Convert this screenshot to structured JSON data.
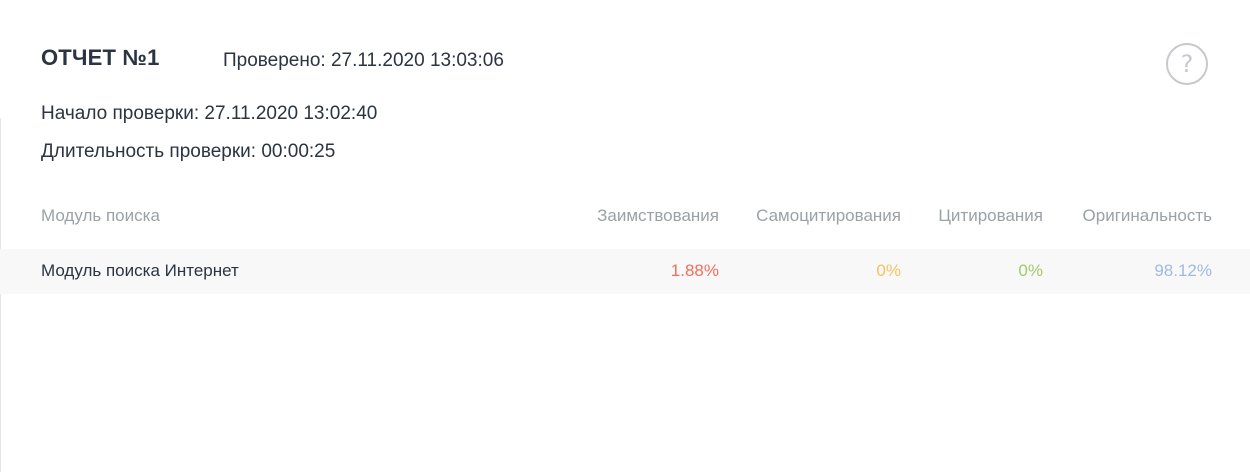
{
  "report": {
    "title": "ОТЧЕТ №1",
    "checked_at": "Проверено: 27.11.2020 13:03:06",
    "start": "Начало проверки: 27.11.2020 13:02:40",
    "duration": "Длительность проверки: 00:00:25",
    "help_glyph": "?"
  },
  "table": {
    "headers": {
      "module": "Модуль поиска",
      "borrowings": "Заимствования",
      "self_citations": "Самоцитирования",
      "citations": "Цитирования",
      "originality": "Оригинальность"
    },
    "rows": [
      {
        "module": "Модуль поиска Интернет",
        "borrowings": "1.88%",
        "self_citations": "0%",
        "citations": "0%",
        "originality": "98.12%"
      }
    ]
  },
  "colors": {
    "borrowings": "#ef6f5a",
    "self_citations": "#f5c25e",
    "citations": "#a6c96a",
    "originality": "#9fbcdc"
  },
  "icons": {
    "help": "question-circle-icon"
  }
}
